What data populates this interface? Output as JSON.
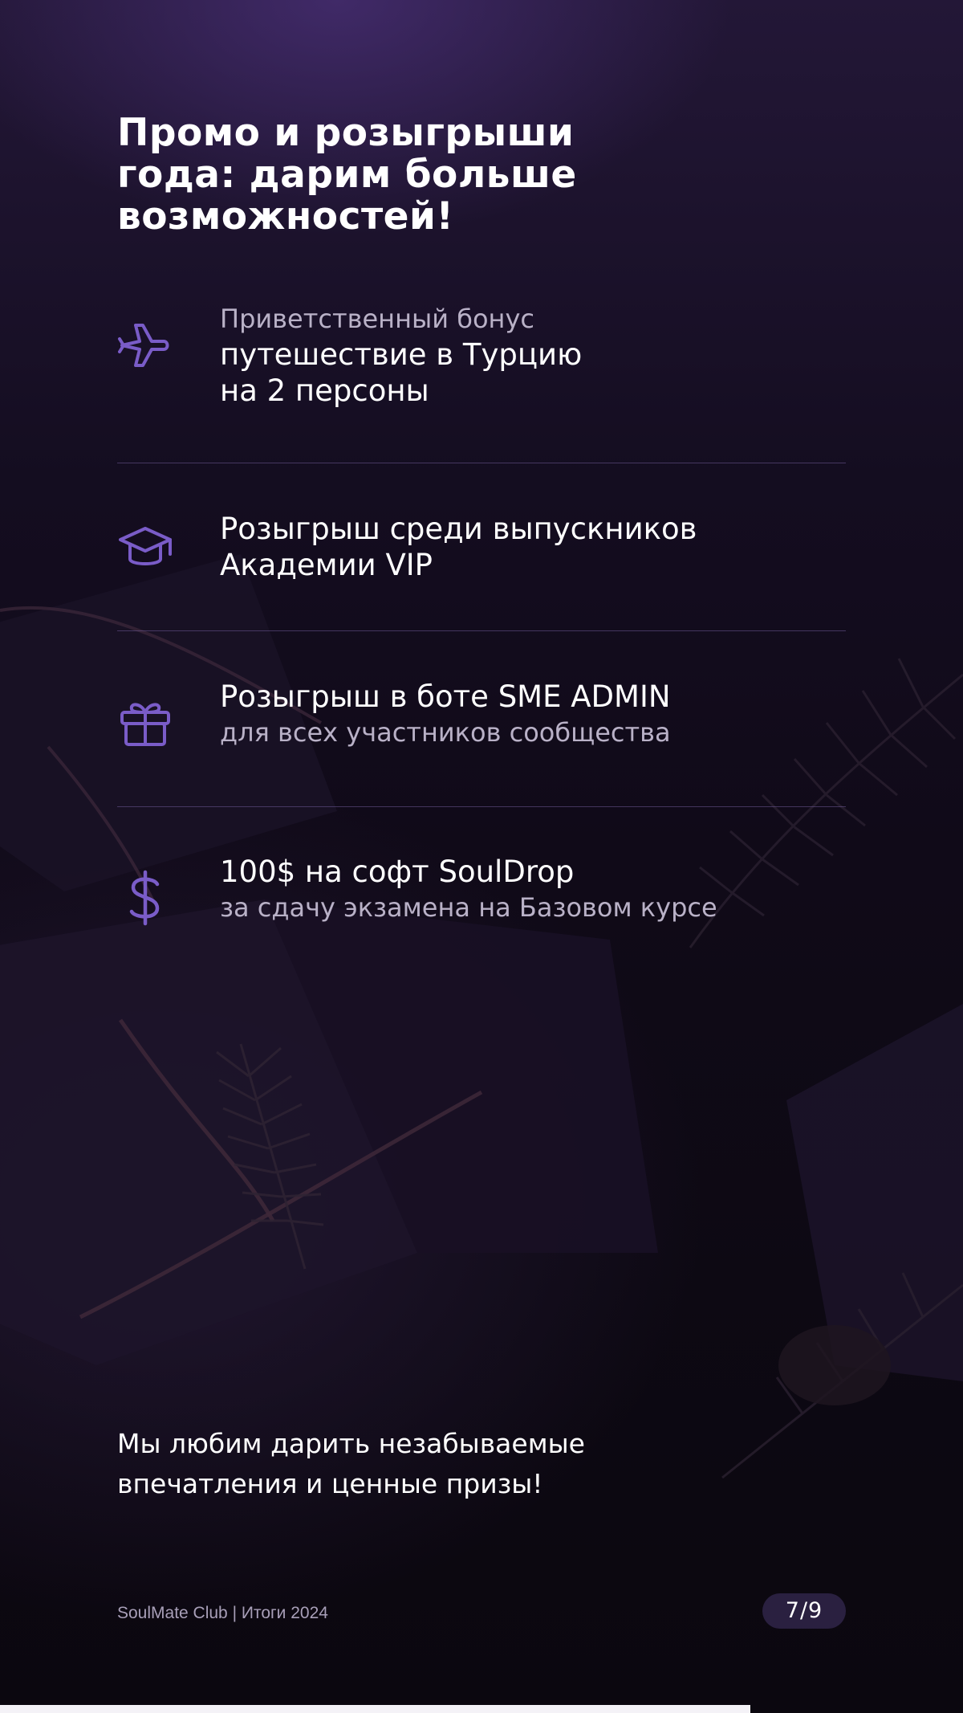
{
  "colors": {
    "accent": "#7a5cc8",
    "background": "#120c1c",
    "text": "#ffffff",
    "muted_text": "#b9b1c7",
    "pager_bg": "#2a2040"
  },
  "title": [
    "Промо и розыгрыши",
    "года: дарим больше",
    "возможностей!"
  ],
  "items": [
    {
      "icon": "airplane-icon",
      "sub_top": "Приветственный бонус",
      "main": [
        "путешествие в Турцию",
        "на 2 персоны"
      ]
    },
    {
      "icon": "graduation-cap-icon",
      "main": [
        "Розыгрыш среди выпускников",
        "Академии VIP"
      ]
    },
    {
      "icon": "gift-icon",
      "main": [
        "Розыгрыш в боте SME ADMIN"
      ],
      "sub_bottom": "для всех участников сообщества"
    },
    {
      "icon": "dollar-icon",
      "main": [
        "100$ на софт SoulDrop"
      ],
      "sub_bottom": "за сдачу экзамена на Базовом курсе"
    }
  ],
  "closing": [
    "Мы любим дарить незабываемые",
    "впечатления и ценные призы!"
  ],
  "footer": {
    "brand": "SoulMate Club | Итоги 2024",
    "pager": "7/9"
  }
}
